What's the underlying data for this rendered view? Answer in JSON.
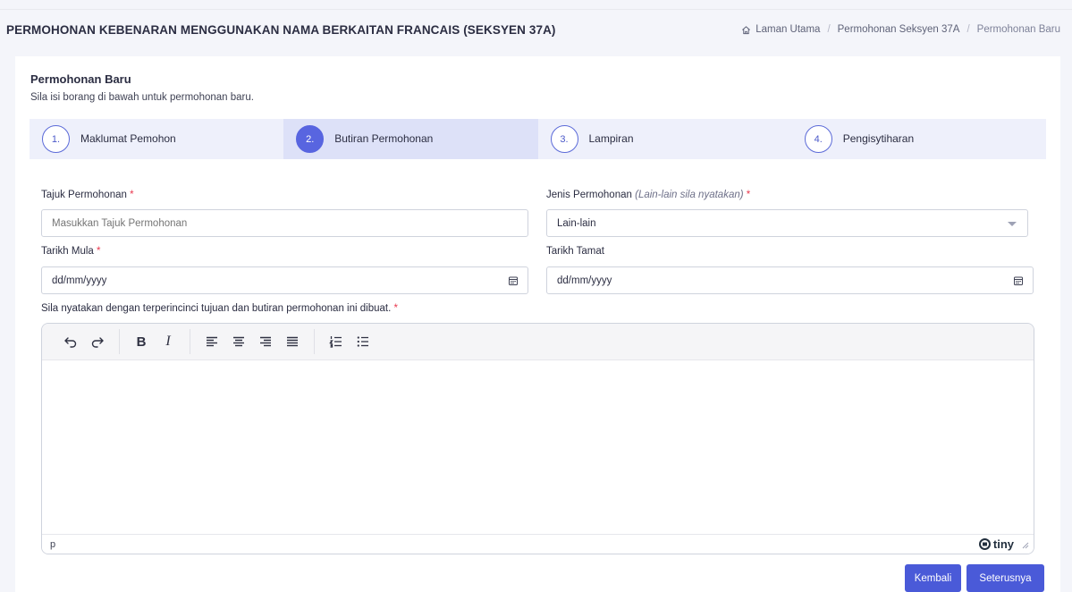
{
  "header": {
    "title": "PERMOHONAN KEBENARAN MENGGUNAKAN NAMA BERKAITAN FRANCAIS (SEKSYEN 37A)",
    "breadcrumb": [
      {
        "label": "Laman Utama",
        "icon": "home-icon"
      },
      {
        "label": "Permohonan Seksyen 37A"
      },
      {
        "label": "Permohonan Baru"
      }
    ],
    "breadcrumb_separator": "/"
  },
  "card": {
    "title": "Permohonan Baru",
    "subtitle": "Sila isi borang di bawah untuk permohonan baru."
  },
  "steps": [
    {
      "number": "1.",
      "label": "Maklumat Pemohon",
      "active": false
    },
    {
      "number": "2.",
      "label": "Butiran Permohonan",
      "active": true
    },
    {
      "number": "3.",
      "label": "Lampiran",
      "active": false
    },
    {
      "number": "4.",
      "label": "Pengisytiharan",
      "active": false
    }
  ],
  "form": {
    "tajuk": {
      "label": "Tajuk Permohonan",
      "required": "*",
      "placeholder": "Masukkan Tajuk Permohonan"
    },
    "jenis": {
      "label": "Jenis Permohonan",
      "hint": "(Lain-lain sila nyatakan)",
      "required": "*",
      "value": "Lain-lain"
    },
    "tarikh_mula": {
      "label": "Tarikh Mula",
      "required": "*",
      "value": "dd/mm/yyyy"
    },
    "tarikh_tamat": {
      "label": "Tarikh Tamat",
      "value": "dd/mm/yyyy"
    },
    "butiran": {
      "label": "Sila nyatakan dengan terperincinci tujuan dan butiran permohonan ini dibuat.",
      "required": "*"
    }
  },
  "editor": {
    "toolbar": {
      "undo": "undo-icon",
      "redo": "redo-icon",
      "bold": "B",
      "italic": "I",
      "align": [
        "align-left-icon",
        "align-center-icon",
        "align-right-icon",
        "align-justify-icon"
      ],
      "lists": [
        "numbered-list-icon",
        "bulleted-list-icon"
      ]
    },
    "status_path": "p",
    "brand": "tiny"
  },
  "actions": {
    "back_label": "Kembali",
    "next_label": "Seterusnya"
  },
  "colors": {
    "accent": "#4a5ad8",
    "step_bg": "#eef0fb",
    "step_active_bg": "#dde1f8",
    "required": "#e9394f"
  }
}
